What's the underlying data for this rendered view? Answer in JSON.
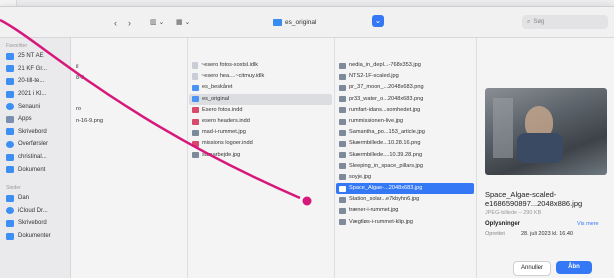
{
  "toolbar": {
    "back": "‹",
    "forward": "›",
    "view_columns": "▥ ⌄",
    "view_grid": "▦ ⌄",
    "folder_name": "es_original",
    "search_placeholder": "Søg"
  },
  "sidebar": {
    "section_favorites": "Favoritter",
    "section_places": "Steder",
    "items": [
      {
        "label": "25 NT AE"
      },
      {
        "label": "21 KF Gr..."
      },
      {
        "label": "20-till-te..."
      },
      {
        "label": "2021 i Kl..."
      },
      {
        "label": "Senauni"
      },
      {
        "label": "Apps"
      },
      {
        "label": "Skrivebord"
      },
      {
        "label": "Overførsler"
      },
      {
        "label": "christinal..."
      },
      {
        "label": "Dokument"
      }
    ],
    "places": [
      {
        "label": "Dan"
      },
      {
        "label": "iCloud Dr..."
      },
      {
        "label": "Skrivebord"
      },
      {
        "label": "Dokumenter"
      }
    ]
  },
  "col1": [
    {
      "label": "il"
    },
    {
      "label": "8-9"
    },
    {
      "label": "ro"
    },
    {
      "label": "n-16-9.png"
    }
  ],
  "col2": [
    {
      "label": "~esero fotos-xoxtsl.idlk"
    },
    {
      "label": "~esero hea....~citmuy.idlk"
    },
    {
      "label": "es_beskåret"
    },
    {
      "label": "es_original"
    },
    {
      "label": "Esero fotos.indd"
    },
    {
      "label": "esero headers.indd"
    },
    {
      "label": "mad-i-rummet.jpg"
    },
    {
      "label": "missions logoer.indd"
    },
    {
      "label": "samarbejde.jpg"
    }
  ],
  "col3": [
    {
      "label": "nedia_in_depl...-768x353.jpg"
    },
    {
      "label": "NTS2-1F-scaled.jpg"
    },
    {
      "label": "pr_37_moon_...2048x683.png"
    },
    {
      "label": "pr33_water_o...2048x683.png"
    },
    {
      "label": "rumfart-idans...somhedet.jpg"
    },
    {
      "label": "rummissionen-live.jpg"
    },
    {
      "label": "Samantha_po...153_article.jpg"
    },
    {
      "label": "Skærmbillede...10.28.16.png"
    },
    {
      "label": "Skærmbillede....10.39.28.png"
    },
    {
      "label": "Sleeping_in_space_pillars.jpg"
    },
    {
      "label": "soyje.jpg"
    },
    {
      "label": "Space_Algae-...2048x683.jpg"
    },
    {
      "label": "Station_solar...e7kbyhn6.jpg"
    },
    {
      "label": "træner-i-rummet.jpg"
    },
    {
      "label": "Vægtløs-i-rummet-klip.jpg"
    }
  ],
  "preview": {
    "filename": "Space_Algae-scaled-e1686590897...2048x886.jpg",
    "kind": "JPEG-billede – 290 KB",
    "info_label": "Oplysninger",
    "more": "Vis mere",
    "date_label": "Oprettet",
    "date_value": "28. juli 2023 kl. 16.40"
  },
  "buttons": {
    "cancel": "Annuller",
    "open": "Åbn"
  },
  "colors": {
    "accent": "#3478f6",
    "annotation": "#d6187a"
  }
}
